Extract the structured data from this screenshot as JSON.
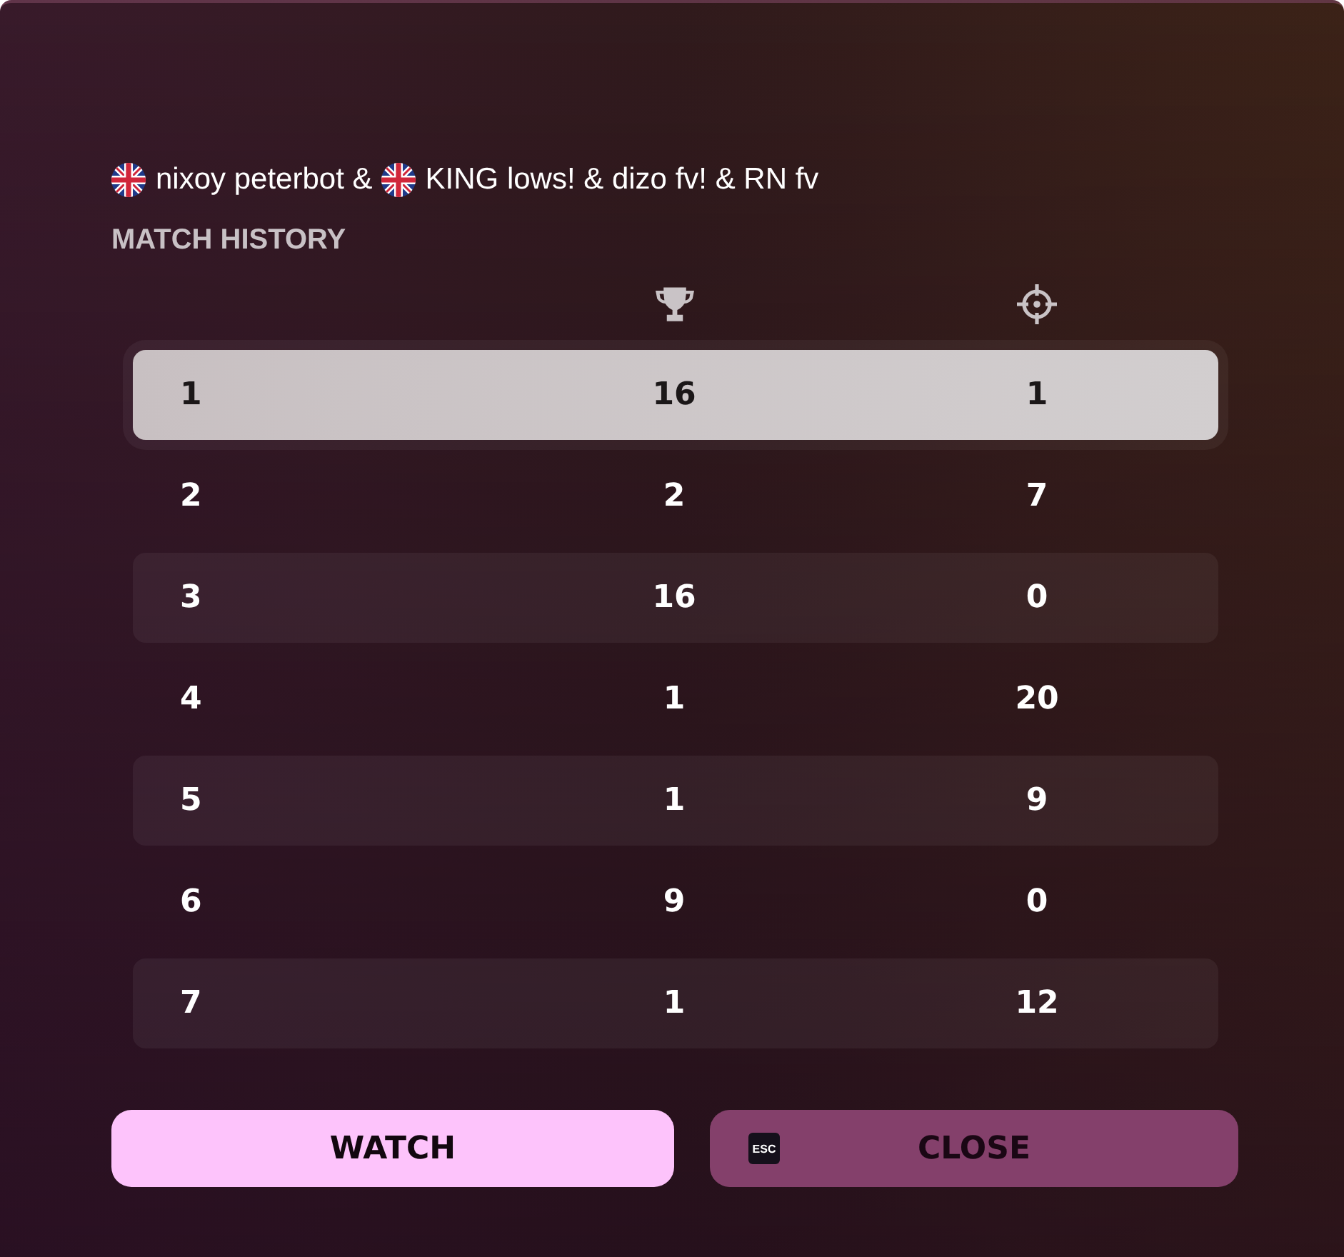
{
  "team": [
    {
      "flag": true,
      "text": "nixoy peterbot &"
    },
    {
      "flag": true,
      "text": "KING lows! & dizo fv! & RN fv"
    }
  ],
  "section_title": "MATCH HISTORY",
  "table": {
    "rows": [
      {
        "selected": true,
        "cells": [
          "1",
          "16",
          "1"
        ]
      },
      {
        "selected": false,
        "cells": [
          "2",
          "2",
          "7"
        ]
      },
      {
        "selected": false,
        "cells": [
          "3",
          "16",
          "0"
        ]
      },
      {
        "selected": false,
        "cells": [
          "4",
          "1",
          "20"
        ]
      },
      {
        "selected": false,
        "cells": [
          "5",
          "1",
          "9"
        ]
      },
      {
        "selected": false,
        "cells": [
          "6",
          "9",
          "0"
        ]
      },
      {
        "selected": false,
        "cells": [
          "7",
          "1",
          "12"
        ]
      }
    ]
  },
  "buttons": [
    {
      "kind": "primary",
      "label": "WATCH"
    },
    {
      "kind": "secondary",
      "label": "CLOSE",
      "key_hint": "ESC"
    }
  ]
}
